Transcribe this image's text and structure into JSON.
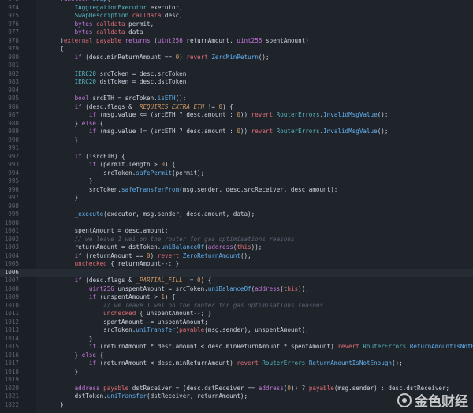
{
  "editor": {
    "language": "solidity",
    "active_line": "1006",
    "watermark_text": "金色财经"
  },
  "code_lines": [
    {
      "n": "973",
      "t": "    function swap("
    },
    {
      "n": "974",
      "t": "        IAggregationExecutor executor,"
    },
    {
      "n": "975",
      "t": "        SwapDescription calldata desc,"
    },
    {
      "n": "976",
      "t": "        bytes calldata permit,"
    },
    {
      "n": "977",
      "t": "        bytes calldata data"
    },
    {
      "n": "978",
      "t": "    )external payable returns (uint256 returnAmount, uint256 spentAmount)"
    },
    {
      "n": "979",
      "t": "    {"
    },
    {
      "n": "980",
      "t": "        if (desc.minReturnAmount == 0) revert ZeroMinReturn();"
    },
    {
      "n": "981",
      "t": ""
    },
    {
      "n": "982",
      "t": "        IERC20 srcToken = desc.srcToken;"
    },
    {
      "n": "983",
      "t": "        IERC20 dstToken = desc.dstToken;"
    },
    {
      "n": "984",
      "t": ""
    },
    {
      "n": "985",
      "t": "        bool srcETH = srcToken.isETH();"
    },
    {
      "n": "986",
      "t": "        if (desc.flags & _REQUIRES_EXTRA_ETH != 0) {"
    },
    {
      "n": "987",
      "t": "            if (msg.value <= (srcETH ? desc.amount : 0)) revert RouterErrors.InvalidMsgValue();"
    },
    {
      "n": "988",
      "t": "        } else {"
    },
    {
      "n": "989",
      "t": "            if (msg.value != (srcETH ? desc.amount : 0)) revert RouterErrors.InvalidMsgValue();"
    },
    {
      "n": "990",
      "t": "        }"
    },
    {
      "n": "991",
      "t": ""
    },
    {
      "n": "992",
      "t": "        if (!srcETH) {"
    },
    {
      "n": "993",
      "t": "            if (permit.length > 0) {"
    },
    {
      "n": "994",
      "t": "                srcToken.safePermit(permit);"
    },
    {
      "n": "995",
      "t": "            }"
    },
    {
      "n": "996",
      "t": "            srcToken.safeTransferFrom(msg.sender, desc.srcReceiver, desc.amount);"
    },
    {
      "n": "997",
      "t": "        }"
    },
    {
      "n": "998",
      "t": ""
    },
    {
      "n": "999",
      "t": "        _execute(executor, msg.sender, desc.amount, data);"
    },
    {
      "n": "1000",
      "t": ""
    },
    {
      "n": "1001",
      "t": "        spentAmount = desc.amount;"
    },
    {
      "n": "1002",
      "t": "        // we leave 1 wei on the router for gas optimisations reasons"
    },
    {
      "n": "1003",
      "t": "        returnAmount = dstToken.uniBalanceOf(address(this));"
    },
    {
      "n": "1004",
      "t": "        if (returnAmount == 0) revert ZeroReturnAmount();"
    },
    {
      "n": "1005",
      "t": "        unchecked { returnAmount--; }"
    },
    {
      "n": "1006",
      "t": ""
    },
    {
      "n": "1007",
      "t": "        if (desc.flags & _PARTIAL_FILL != 0) {"
    },
    {
      "n": "1008",
      "t": "            uint256 unspentAmount = srcToken.uniBalanceOf(address(this));"
    },
    {
      "n": "1009",
      "t": "            if (unspentAmount > 1) {"
    },
    {
      "n": "1010",
      "t": "                // we leave 1 wei on the router for gas optimisations reasons"
    },
    {
      "n": "1011",
      "t": "                unchecked { unspentAmount--; }"
    },
    {
      "n": "1012",
      "t": "                spentAmount -= unspentAmount;"
    },
    {
      "n": "1013",
      "t": "                srcToken.uniTransfer(payable(msg.sender), unspentAmount);"
    },
    {
      "n": "1014",
      "t": "            }"
    },
    {
      "n": "1015",
      "t": "            if (returnAmount * desc.amount < desc.minReturnAmount * spentAmount) revert RouterErrors.ReturnAmountIsNotEnough();"
    },
    {
      "n": "1016",
      "t": "        } else {"
    },
    {
      "n": "1017",
      "t": "            if (returnAmount < desc.minReturnAmount) revert RouterErrors.ReturnAmountIsNotEnough();"
    },
    {
      "n": "1018",
      "t": "        }"
    },
    {
      "n": "1019",
      "t": ""
    },
    {
      "n": "1020",
      "t": "        address payable dstReceiver = (desc.dstReceiver == address(0)) ? payable(msg.sender) : desc.dstReceiver;"
    },
    {
      "n": "1021",
      "t": "        dstToken.uniTransfer(dstReceiver, returnAmount);"
    },
    {
      "n": "1022",
      "t": "    }"
    }
  ]
}
